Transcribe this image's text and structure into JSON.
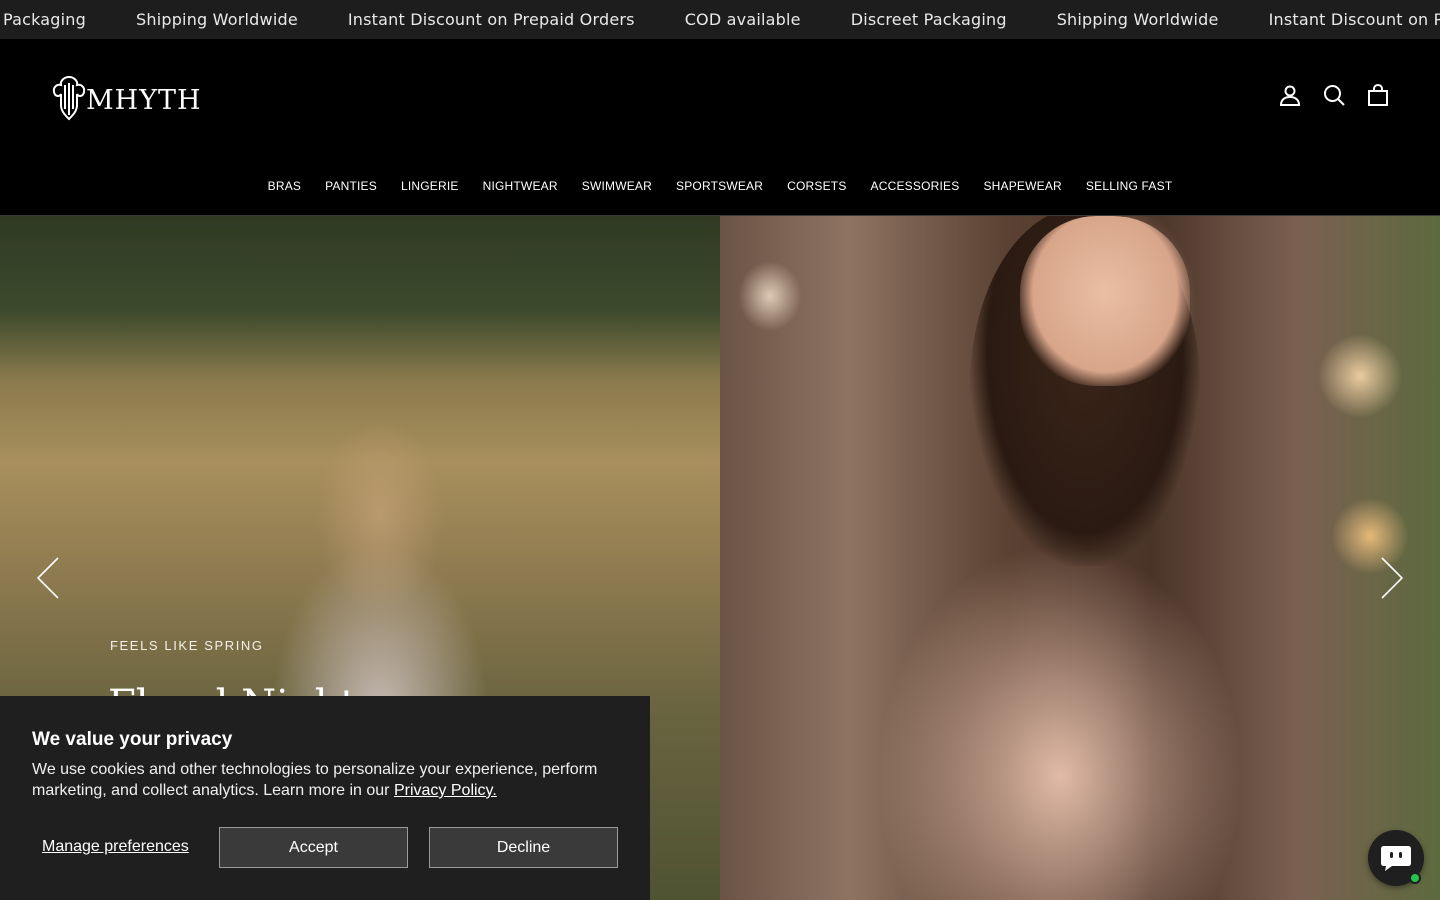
{
  "announcement": {
    "items": [
      "Discreet Packaging",
      "Shipping Worldwide",
      "Instant Discount on Prepaid Orders",
      "COD available",
      "Discreet Packaging",
      "Shipping Worldwide",
      "Instant Discount on Prepaid Orders"
    ]
  },
  "header": {
    "logo_text": "MHYTH",
    "icons": [
      "account-icon",
      "search-icon",
      "cart-icon"
    ]
  },
  "nav": {
    "items": [
      "BRAS",
      "PANTIES",
      "LINGERIE",
      "NIGHTWEAR",
      "SWIMWEAR",
      "SPORTSWEAR",
      "CORSETS",
      "ACCESSORIES",
      "SHAPEWEAR",
      "SELLING FAST"
    ]
  },
  "hero": {
    "eyebrow": "FEELS LIKE SPRING",
    "headline": "Floral Nights"
  },
  "cookie": {
    "title": "We value your privacy",
    "body": "We use cookies and other technologies to personalize your experience, perform marketing, and collect analytics. Learn more in our",
    "link": "Privacy Policy.",
    "manage": "Manage preferences",
    "accept": "Accept",
    "decline": "Decline"
  },
  "colors": {
    "header_bg": "#000000",
    "ticker_bg": "#1d1d1d",
    "banner_bg": "#1f1f1f",
    "chat_status": "#26c24b"
  }
}
